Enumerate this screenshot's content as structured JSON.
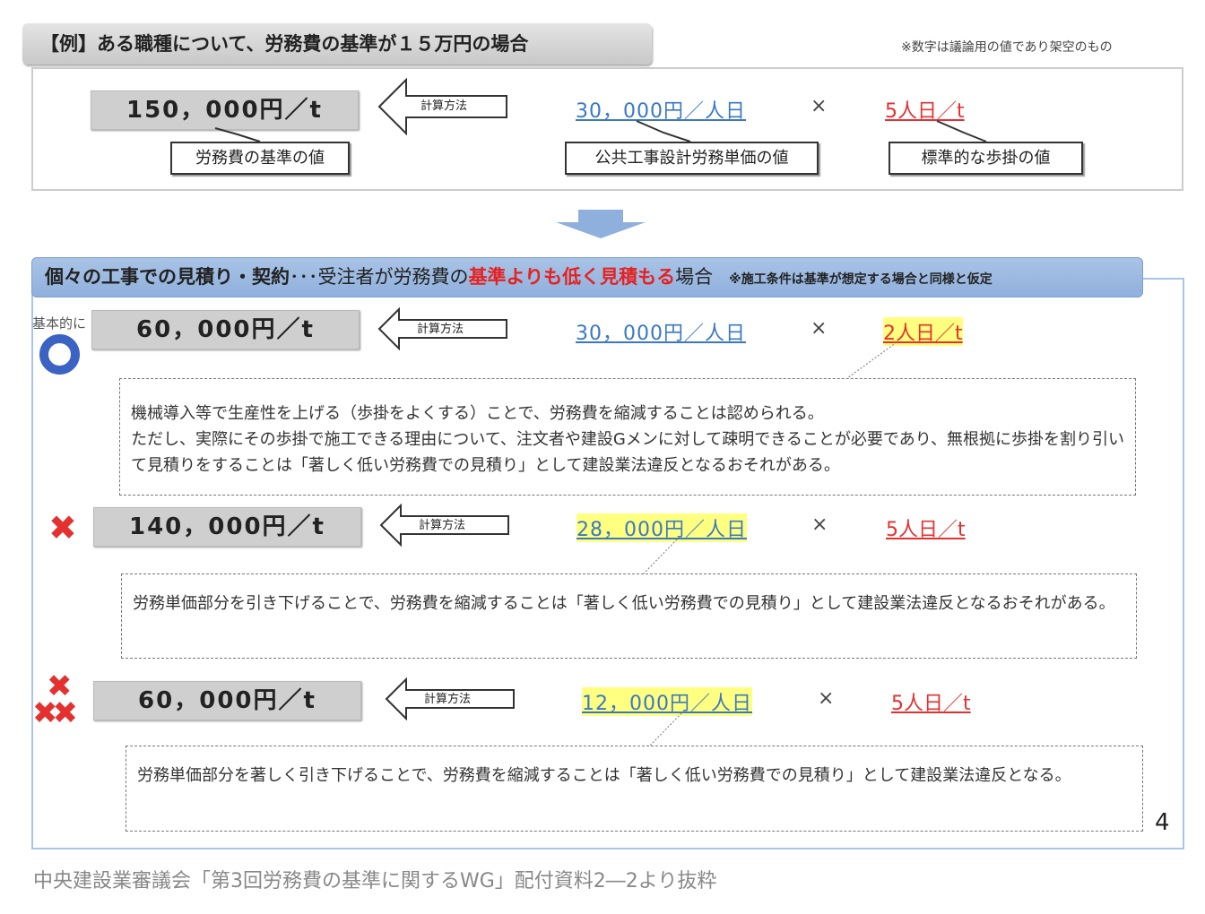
{
  "header": {
    "title": "【例】ある職種について、労務費の基準が１５万円の場合",
    "note": "※数字は議論用の値であり架空のもの"
  },
  "example": {
    "result": "150，000円／t",
    "method": "計算方法",
    "unit_price": "30，000円／人日",
    "times": "×",
    "productivity": "5人日／t",
    "labels": [
      "労務費の基準の値",
      "公共工事設計労務単価の値",
      "標準的な歩掛の値"
    ]
  },
  "section": {
    "title_bold": "個々の工事での見積り・契約",
    "title_mid": "･･･受注者が労務費の",
    "title_red": "基準よりも低く見積もる",
    "title_end": "場合",
    "note": "※施工条件は基準が想定する場合と同様と仮定"
  },
  "cases": [
    {
      "mark": "○",
      "prefix": "基本的に",
      "result": "60，000円／t",
      "method": "計算方法",
      "unit_price": "30，000円／人日",
      "times": "×",
      "productivity": "2人日／t",
      "text": [
        "機械導入等で生産性を上げる（歩掛をよくする）ことで、労務費を縮減することは認められる。",
        "ただし、実際にその歩掛で施工できる理由について、注文者や建設Gメンに対して疎明できることが必要であり、無根拠に歩掛を割り引いて見積りをすることは「著しく低い労務費での見積り」として建設業法違反となるおそれがある。"
      ]
    },
    {
      "mark": "✖",
      "result": "140，000円／t",
      "method": "計算方法",
      "unit_price": "28，000円／人日",
      "times": "×",
      "productivity": "5人日／t",
      "text": [
        "労務単価部分を引き下げることで、労務費を縮減することは「著しく低い労務費での見積り」として建設業法違反となるおそれがある。"
      ]
    },
    {
      "mark": "✖✖✖",
      "result": "60，000円／t",
      "method": "計算方法",
      "unit_price": "12，000円／人日",
      "times": "×",
      "productivity": "5人日／t",
      "text": [
        "労務単価部分を著しく引き下げることで、労務費を縮減することは「著しく低い労務費での見積り」として建設業法違反となる。"
      ]
    }
  ],
  "page_number": "4",
  "caption": "中央建設業審議会「第3回労務費の基準に関するWG」配付資料2―2より抜粋",
  "colors": {
    "blue": "#3a78c4",
    "red": "#e53030",
    "highlight": "#ffff80"
  }
}
